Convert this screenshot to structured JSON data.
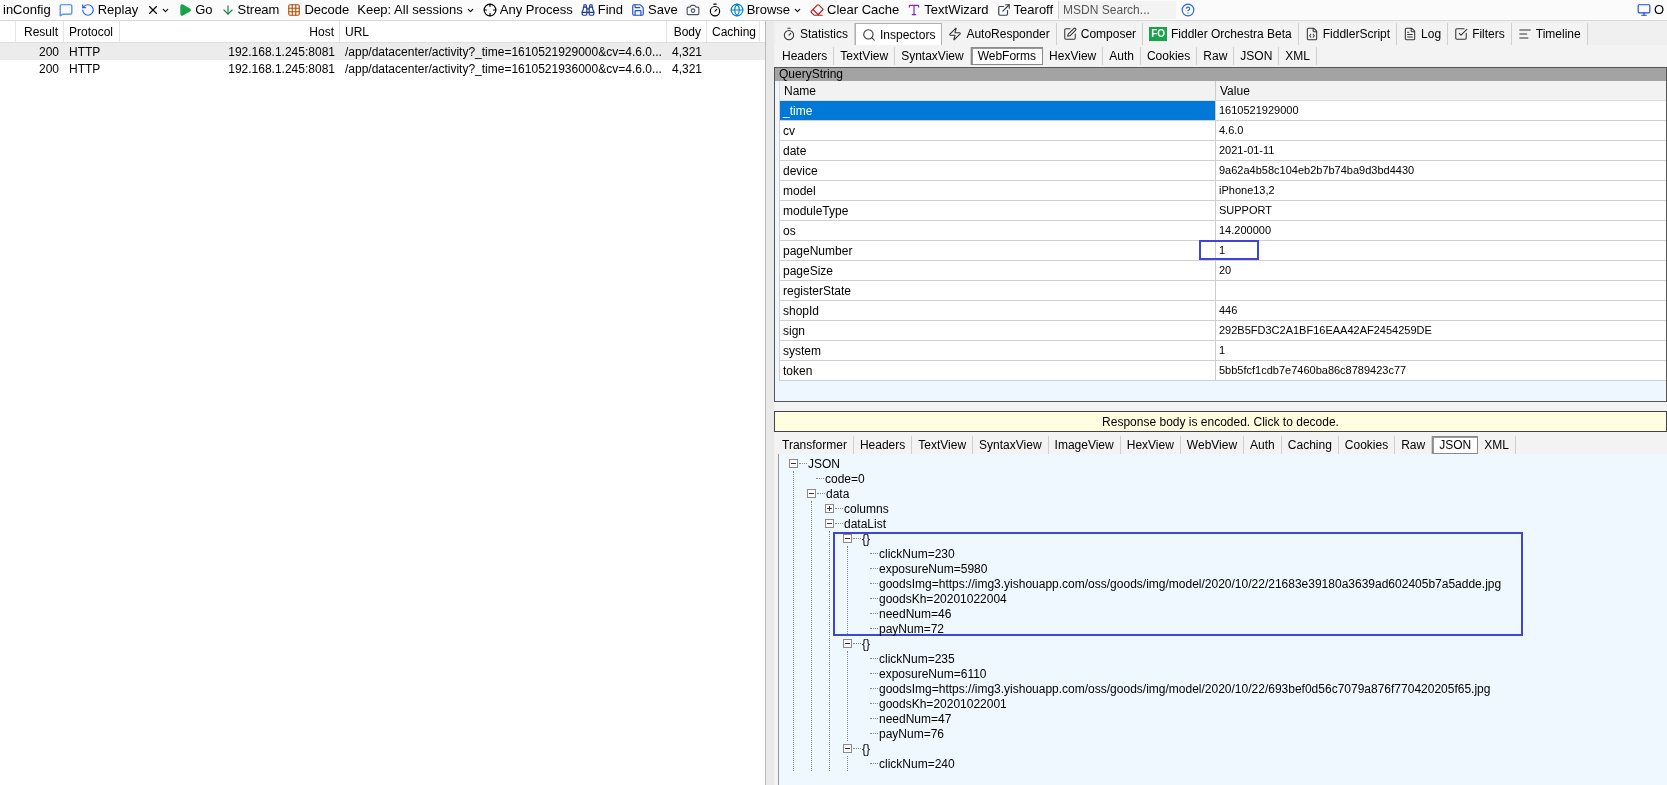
{
  "toolbar": [
    {
      "kind": "button",
      "label": "inConfig"
    },
    {
      "kind": "icon"
    },
    {
      "kind": "button",
      "label": "Replay"
    },
    {
      "kind": "menu"
    },
    {
      "kind": "button",
      "label": "Go"
    },
    {
      "kind": "button",
      "label": "Stream"
    },
    {
      "kind": "button",
      "label": "Decode"
    },
    {
      "kind": "dropdown",
      "label": "Keep: All sessions"
    },
    {
      "kind": "button",
      "label": "Any Process"
    },
    {
      "kind": "button",
      "label": "Find"
    },
    {
      "kind": "button",
      "label": "Save"
    },
    {
      "kind": "icon"
    },
    {
      "kind": "icon"
    },
    {
      "kind": "dropdown",
      "label": "Browse"
    },
    {
      "kind": "button",
      "label": "Clear Cache"
    },
    {
      "kind": "button",
      "label": "TextWizard"
    },
    {
      "kind": "button",
      "label": "Tearoff"
    },
    {
      "kind": "search",
      "placeholder": "MSDN Search..."
    },
    {
      "kind": "icon"
    },
    {
      "kind": "button",
      "label": "O"
    }
  ],
  "sessions": {
    "columns": [
      "",
      "Result",
      "Protocol",
      "Host",
      "URL",
      "Body",
      "Caching"
    ],
    "rows": [
      {
        "selected": true,
        "cells": [
          "",
          "200",
          "HTTP",
          "192.168.1.245:8081",
          "/app/datacenter/activity?_time=1610521929000&cv=4.6.0...",
          "4,321",
          ""
        ]
      },
      {
        "selected": false,
        "cells": [
          "",
          "200",
          "HTTP",
          "192.168.1.245:8081",
          "/app/datacenter/activity?_time=1610521936000&cv=4.6.0...",
          "4,321",
          ""
        ]
      }
    ]
  },
  "inspector_tabs": [
    {
      "label": "Statistics",
      "selected": false
    },
    {
      "label": "Inspectors",
      "selected": true
    },
    {
      "label": "AutoResponder",
      "selected": false
    },
    {
      "label": "Composer",
      "selected": false
    },
    {
      "label": "Fiddler Orchestra Beta",
      "badge": "FO",
      "selected": false
    },
    {
      "label": "FiddlerScript",
      "selected": false
    },
    {
      "label": "Log",
      "selected": false
    },
    {
      "label": "Filters",
      "selected": false
    },
    {
      "label": "Timeline",
      "selected": false
    }
  ],
  "request_tabs": [
    {
      "label": "Headers",
      "selected": false
    },
    {
      "label": "TextView",
      "selected": false
    },
    {
      "label": "SyntaxView",
      "selected": false
    },
    {
      "label": "WebForms",
      "selected": true
    },
    {
      "label": "HexView",
      "selected": false
    },
    {
      "label": "Auth",
      "selected": false
    },
    {
      "label": "Cookies",
      "selected": false
    },
    {
      "label": "Raw",
      "selected": false
    },
    {
      "label": "JSON",
      "selected": false
    },
    {
      "label": "XML",
      "selected": false
    }
  ],
  "querystring": {
    "title": "QueryString",
    "columns": [
      "Name",
      "Value"
    ],
    "rows": [
      {
        "name": "_time",
        "value": "1610521929000",
        "selected": true,
        "highlighted": false
      },
      {
        "name": "cv",
        "value": "4.6.0",
        "selected": false,
        "highlighted": false
      },
      {
        "name": "date",
        "value": "2021-01-11",
        "selected": false,
        "highlighted": false
      },
      {
        "name": "device",
        "value": "9a62a4b58c104eb2b7b74ba9d3bd4430",
        "selected": false,
        "highlighted": false
      },
      {
        "name": "model",
        "value": "iPhone13,2",
        "selected": false,
        "highlighted": false
      },
      {
        "name": "moduleType",
        "value": "SUPPORT",
        "selected": false,
        "highlighted": false
      },
      {
        "name": "os",
        "value": "14.200000",
        "selected": false,
        "highlighted": false
      },
      {
        "name": "pageNumber",
        "value": "1",
        "selected": false,
        "highlighted": true
      },
      {
        "name": "pageSize",
        "value": "20",
        "selected": false,
        "highlighted": false
      },
      {
        "name": "registerState",
        "selected": false,
        "highlighted": false
      },
      {
        "name": "shopId",
        "value": "446",
        "selected": false,
        "highlighted": false
      },
      {
        "name": "sign",
        "value": "292B5FD3C2A1BF16EAA42AF2454259DE",
        "selected": false,
        "highlighted": false
      },
      {
        "name": "system",
        "value": "1",
        "selected": false,
        "highlighted": false
      },
      {
        "name": "token",
        "value": "5bb5fcf1cdb7e7460ba86c8789423c77",
        "selected": false,
        "highlighted": false
      }
    ]
  },
  "response_notice": "Response body is encoded. Click to decode.",
  "response_tabs": [
    {
      "label": "Transformer",
      "selected": false
    },
    {
      "label": "Headers",
      "selected": false
    },
    {
      "label": "TextView",
      "selected": false
    },
    {
      "label": "SyntaxView",
      "selected": false
    },
    {
      "label": "ImageView",
      "selected": false
    },
    {
      "label": "HexView",
      "selected": false
    },
    {
      "label": "WebView",
      "selected": false
    },
    {
      "label": "Auth",
      "selected": false
    },
    {
      "label": "Caching",
      "selected": false
    },
    {
      "label": "Cookies",
      "selected": false
    },
    {
      "label": "Raw",
      "selected": false
    },
    {
      "label": "JSON",
      "selected": true
    },
    {
      "label": "XML",
      "selected": false
    }
  ],
  "tree": [
    {
      "label": "JSON",
      "expanded": true,
      "children": [
        {
          "label": "code=0"
        },
        {
          "label": "data",
          "expanded": true,
          "children": [
            {
              "label": "columns",
              "expanded": false
            },
            {
              "label": "dataList",
              "expanded": true,
              "children": [
                {
                  "label": "{}",
                  "expanded": true,
                  "highlighted": true,
                  "children": [
                    {
                      "label": "clickNum=230"
                    },
                    {
                      "label": "exposureNum=5980"
                    },
                    {
                      "label": "goodsImg=https://img3.yishouapp.com/oss/goods/img/model/2020/10/22/21683e39180a3639ad602405b7a5adde.jpg"
                    },
                    {
                      "label": "goodsKh=20201022004"
                    },
                    {
                      "label": "needNum=46"
                    },
                    {
                      "label": "payNum=72"
                    }
                  ]
                },
                {
                  "label": "{}",
                  "expanded": true,
                  "highlighted": false,
                  "children": [
                    {
                      "label": "clickNum=235"
                    },
                    {
                      "label": "exposureNum=6110"
                    },
                    {
                      "label": "goodsImg=https://img3.yishouapp.com/oss/goods/img/model/2020/10/22/693bef0d56c7079a876f770420205f65.jpg"
                    },
                    {
                      "label": "goodsKh=20201022001"
                    },
                    {
                      "label": "needNum=47"
                    },
                    {
                      "label": "payNum=76"
                    }
                  ]
                },
                {
                  "label": "{}",
                  "expanded": true,
                  "highlighted": false,
                  "children": [
                    {
                      "label": "clickNum=240"
                    }
                  ]
                }
              ]
            }
          ]
        }
      ]
    }
  ]
}
